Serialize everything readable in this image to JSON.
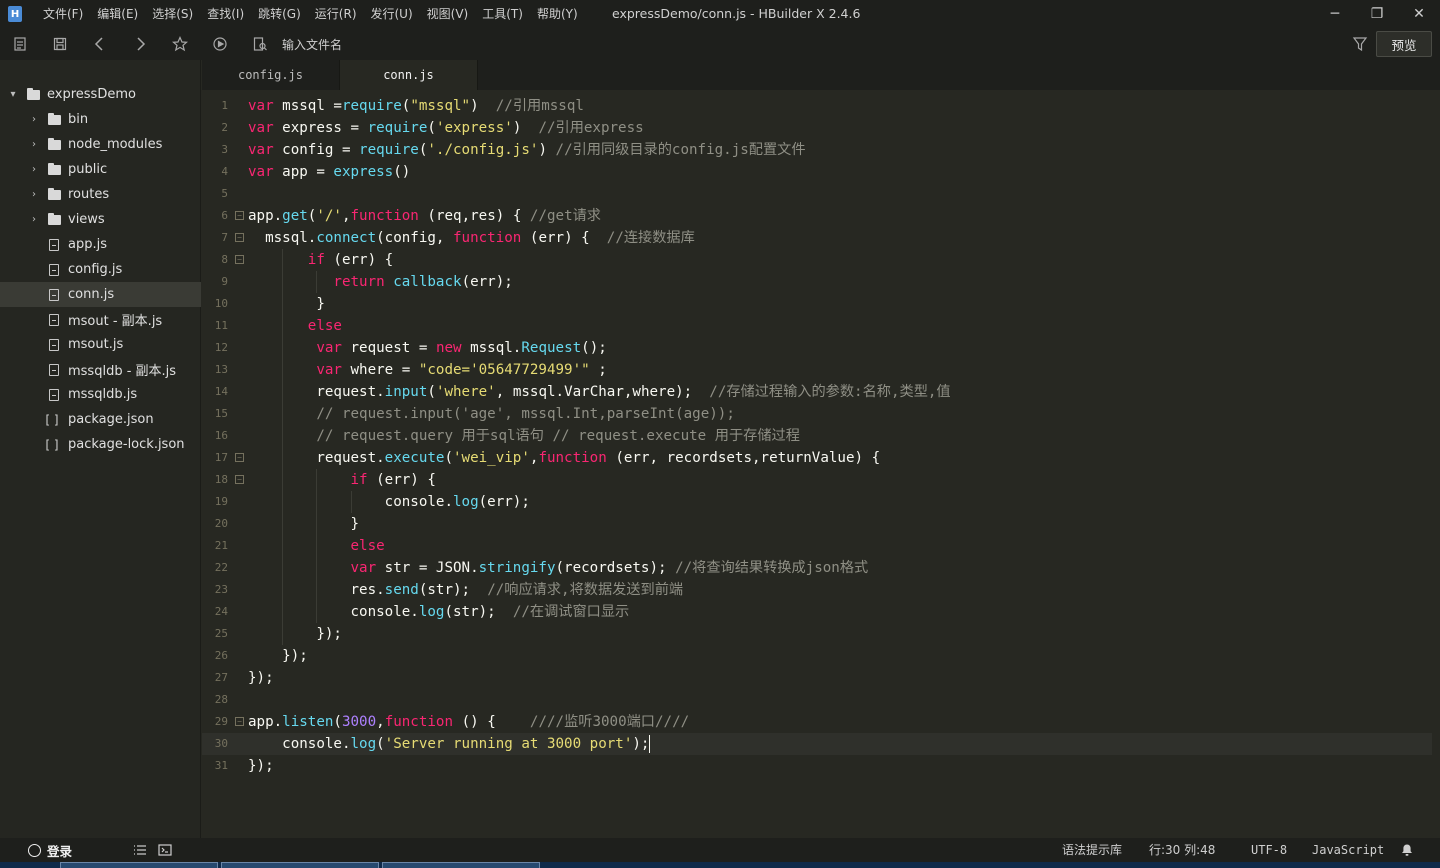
{
  "window": {
    "title": "expressDemo/conn.js - HBuilder X 2.4.6",
    "app_logo": "H",
    "controls": {
      "minimize": "─",
      "restore": "❐",
      "close": "✕"
    }
  },
  "menu": [
    "文件(F)",
    "编辑(E)",
    "选择(S)",
    "查找(I)",
    "跳转(G)",
    "运行(R)",
    "发行(U)",
    "视图(V)",
    "工具(T)",
    "帮助(Y)"
  ],
  "toolbar": {
    "file_search_label": "输入文件名",
    "preview_label": "预览",
    "icons": [
      "new-file-icon",
      "save-icon",
      "back-icon",
      "forward-icon",
      "star-icon",
      "run-icon",
      "file-search-icon"
    ]
  },
  "sidebar": {
    "items": [
      {
        "label": "expressDemo",
        "kind": "folder",
        "expanded": true
      },
      {
        "label": "bin",
        "kind": "folder"
      },
      {
        "label": "node_modules",
        "kind": "folder"
      },
      {
        "label": "public",
        "kind": "folder"
      },
      {
        "label": "routes",
        "kind": "folder"
      },
      {
        "label": "views",
        "kind": "folder"
      },
      {
        "label": "app.js",
        "kind": "file"
      },
      {
        "label": "config.js",
        "kind": "file"
      },
      {
        "label": "conn.js",
        "kind": "file",
        "selected": true
      },
      {
        "label": "msout - 副本.js",
        "kind": "file"
      },
      {
        "label": "msout.js",
        "kind": "file"
      },
      {
        "label": "mssqldb - 副本.js",
        "kind": "file"
      },
      {
        "label": "mssqldb.js",
        "kind": "file"
      },
      {
        "label": "package.json",
        "kind": "json"
      },
      {
        "label": "package-lock.json",
        "kind": "json"
      }
    ]
  },
  "tabs": [
    {
      "label": "config.js",
      "active": false
    },
    {
      "label": "conn.js",
      "active": true
    }
  ],
  "editor": {
    "lines": [
      {
        "n": "1",
        "fold": false,
        "text": "var mssql =require(\"mssql\")  //引用mssql"
      },
      {
        "n": "2",
        "fold": false,
        "text": "var express = require('express')  //引用express"
      },
      {
        "n": "3",
        "fold": false,
        "text": "var config = require('./config.js') //引用同级目录的config.js配置文件"
      },
      {
        "n": "4",
        "fold": false,
        "text": "var app = express()"
      },
      {
        "n": "5",
        "fold": false,
        "text": ""
      },
      {
        "n": "6",
        "fold": true,
        "text": "app.get('/',function (req,res) { //get请求"
      },
      {
        "n": "7",
        "fold": true,
        "text": "  mssql.connect(config, function (err) {  //连接数据库"
      },
      {
        "n": "8",
        "fold": true,
        "text": "       if (err) {"
      },
      {
        "n": "9",
        "fold": false,
        "text": "          return callback(err);"
      },
      {
        "n": "10",
        "fold": false,
        "text": "        }"
      },
      {
        "n": "11",
        "fold": false,
        "text": "       else"
      },
      {
        "n": "12",
        "fold": false,
        "text": "        var request = new mssql.Request();"
      },
      {
        "n": "13",
        "fold": false,
        "text": "        var where = \"code='05647729499'\" ;"
      },
      {
        "n": "14",
        "fold": false,
        "text": "        request.input('where', mssql.VarChar,where);  //存储过程输入的参数:名称,类型,值"
      },
      {
        "n": "15",
        "fold": false,
        "text": "        // request.input('age', mssql.Int,parseInt(age));"
      },
      {
        "n": "16",
        "fold": false,
        "text": "        // request.query 用于sql语句 // request.execute 用于存储过程"
      },
      {
        "n": "17",
        "fold": true,
        "text": "        request.execute('wei_vip',function (err, recordsets,returnValue) {"
      },
      {
        "n": "18",
        "fold": true,
        "text": "            if (err) {"
      },
      {
        "n": "19",
        "fold": false,
        "text": "                console.log(err);"
      },
      {
        "n": "20",
        "fold": false,
        "text": "            }"
      },
      {
        "n": "21",
        "fold": false,
        "text": "            else"
      },
      {
        "n": "22",
        "fold": false,
        "text": "            var str = JSON.stringify(recordsets); //将查询结果转换成json格式"
      },
      {
        "n": "23",
        "fold": false,
        "text": "            res.send(str);  //响应请求,将数据发送到前端"
      },
      {
        "n": "24",
        "fold": false,
        "text": "            console.log(str);  //在调试窗口显示"
      },
      {
        "n": "25",
        "fold": false,
        "text": "        });"
      },
      {
        "n": "26",
        "fold": false,
        "text": "    });"
      },
      {
        "n": "27",
        "fold": false,
        "text": "});"
      },
      {
        "n": "28",
        "fold": false,
        "text": ""
      },
      {
        "n": "29",
        "fold": true,
        "text": "app.listen(3000,function () {    ////监听3000端口////"
      },
      {
        "n": "30",
        "fold": false,
        "text": "    console.log('Server running at 3000 port');",
        "current": true
      },
      {
        "n": "31",
        "fold": false,
        "text": "});"
      }
    ]
  },
  "statusbar": {
    "login_label": "登录",
    "hint_library": "语法提示库",
    "position": "行:30  列:48",
    "encoding": "UTF-8",
    "language": "JavaScript"
  },
  "colors": {
    "keyword": "#f92672",
    "function": "#66d9ef",
    "string": "#e6db74",
    "number": "#ae81ff",
    "comment": "#8f8f85",
    "background": "#272822"
  }
}
